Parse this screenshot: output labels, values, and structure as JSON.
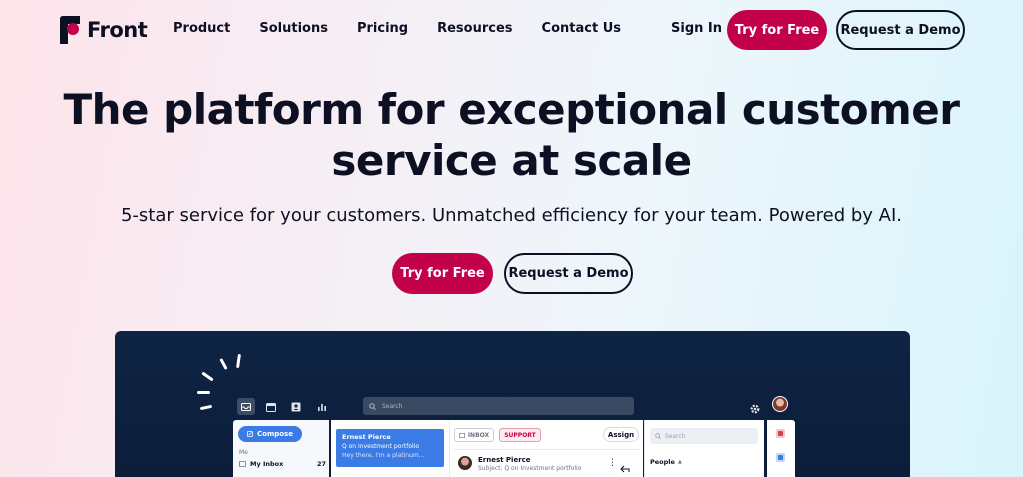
{
  "brand": {
    "name": "Front",
    "accent": "#c3004a",
    "dark": "#0d1023"
  },
  "nav": {
    "links": [
      "Product",
      "Solutions",
      "Pricing",
      "Resources",
      "Contact Us"
    ],
    "sign_in": "Sign In",
    "try_free": "Try for Free",
    "request_demo": "Request a Demo"
  },
  "hero": {
    "title_line1": "The platform for exceptional customer",
    "title_line2": "service at scale",
    "subtitle": "5-star service for your customers. Unmatched efficiency for your team. Powered by AI.",
    "cta_primary": "Try for Free",
    "cta_secondary": "Request a Demo"
  },
  "app": {
    "search_placeholder": "Search",
    "compose": "Compose",
    "section_me": "Me",
    "inbox_label": "My Inbox",
    "inbox_count": "27",
    "selected_message": {
      "sender": "Ernest Pierce",
      "subject": "Q on Investment portfolio",
      "preview": "Hey there, I'm a platinum..."
    },
    "tags": {
      "inbox": "INBOX",
      "support": "SUPPORT"
    },
    "assign": "Assign",
    "conversation": {
      "sender": "Ernest Pierce",
      "subject": "Subject: Q on Investment portfolio"
    },
    "right_search": "Search",
    "people": "People"
  }
}
